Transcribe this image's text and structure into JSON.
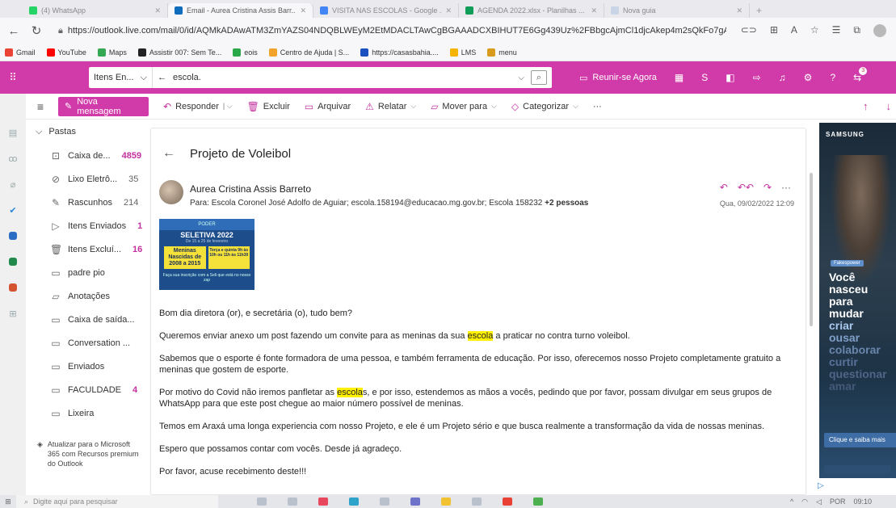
{
  "browser": {
    "tabs": [
      {
        "title": "(4) WhatsApp",
        "active": false
      },
      {
        "title": "Email - Aurea Cristina Assis Barr...",
        "active": true
      },
      {
        "title": "VISITA NAS ESCOLAS - Google ...",
        "active": false
      },
      {
        "title": "AGENDA 2022.xlsx - Planilhas ...",
        "active": false
      },
      {
        "title": "Nova guia",
        "active": false
      }
    ],
    "url": "https://outlook.live.com/mail/0/id/AQMkADAwATM3ZmYAZS04NDQBLWEyM2EtMDACLTAwCgBGAAADCXBIHUT7E6Gg439Uz%2FBbgcAjmCl1djcAkep4m2sQkFo7gAA...",
    "bookmarks": [
      {
        "label": "Gmail",
        "color": "#ea4335"
      },
      {
        "label": "YouTube",
        "color": "#ff0000"
      },
      {
        "label": "Maps",
        "color": "#34a853"
      },
      {
        "label": "Assistir 007: Sem Te...",
        "color": "#222222"
      },
      {
        "label": "eois",
        "color": "#2aa84a"
      },
      {
        "label": "Centro de Ajuda | S...",
        "color": "#f1a32b"
      },
      {
        "label": "https://casasbahia....",
        "color": "#1a4fbf"
      },
      {
        "label": "LMS",
        "color": "#f5b400"
      },
      {
        "label": "menu",
        "color": "#d99b1e"
      }
    ]
  },
  "header": {
    "scope_label": "Itens En...",
    "search_value": "escola.",
    "meet_label": "Reunir-se Agora",
    "notification_count": "3"
  },
  "commands": {
    "new_message": "Nova mensagem",
    "reply": "Responder",
    "delete": "Excluir",
    "archive": "Arquivar",
    "report": "Relatar",
    "move_to": "Mover para",
    "categorize": "Categorizar",
    "more": "···"
  },
  "folders": {
    "title": "Pastas",
    "items": [
      {
        "label": "Caixa de...",
        "count": "4859",
        "bold": true,
        "icon": "inbox-icon"
      },
      {
        "label": "Lixo Eletrô...",
        "count": "35",
        "bold": false,
        "icon": "junk-icon"
      },
      {
        "label": "Rascunhos",
        "count": "214",
        "bold": false,
        "icon": "drafts-icon"
      },
      {
        "label": "Itens Enviados",
        "count": "1",
        "bold": true,
        "icon": "sent-icon"
      },
      {
        "label": "Itens Excluí...",
        "count": "16",
        "bold": true,
        "icon": "trash-icon"
      },
      {
        "label": "padre pio",
        "count": "",
        "bold": false,
        "icon": "archive-icon"
      },
      {
        "label": "Anotações",
        "count": "",
        "bold": false,
        "icon": "notes-icon"
      },
      {
        "label": "Caixa de saída...",
        "count": "",
        "bold": false,
        "icon": "folder-icon"
      },
      {
        "label": "Conversation ...",
        "count": "",
        "bold": false,
        "icon": "folder-icon"
      },
      {
        "label": "Enviados",
        "count": "",
        "bold": false,
        "icon": "folder-icon"
      },
      {
        "label": "FACULDADE",
        "count": "4",
        "bold": true,
        "icon": "folder-icon"
      },
      {
        "label": "Lixeira",
        "count": "",
        "bold": false,
        "icon": "folder-icon"
      }
    ],
    "upgrade_text": "Atualizar para o Microsoft 365 com Recursos premium do Outlook"
  },
  "message": {
    "subject": "Projeto de Voleibol",
    "sender": "Aurea Cristina Assis Barreto",
    "to_label": "Para:",
    "recipients": "Escola Coronel José Adolfo de Aguiar;  escola.158194@educacao.mg.gov.br;  Escola 158232",
    "more_recipients": "+2 pessoas",
    "date": "Qua, 09/02/2022 12:09",
    "poster": {
      "top": "PODER",
      "title": "SELETIVA 2022",
      "sub": "De 15 a 25 de fevereiro",
      "box1": "Meninas Nascidas de 2008 a 2015",
      "box2": "Terça e quinta 9h às 10h ou 11h às 11h30",
      "foot": "Faça sua inscrição com a Seli que está no nosso zap"
    },
    "greeting": "Bom dia diretora (or), e secretária (o), tudo bem?",
    "p1_before": "Queremos enviar anexo um post fazendo um convite para as meninas da sua ",
    "p1_mark": "escola",
    "p1_after": " a praticar no contra turno voleibol.",
    "p2": "Sabemos que o esporte é fonte formadora de uma pessoa, e também ferramenta de educação. Por isso, oferecemos nosso Projeto completamente gratuito a meninas que gostem de esporte.",
    "p3_before": "Por motivo do Covid não iremos panfletar as ",
    "p3_mark": "escola",
    "p3_after": "s, e por isso, estendemos as mãos a vocês, pedindo que por favor, possam divulgar em seus grupos de WhatsApp para que este post chegue ao maior número possível de meninas.",
    "p4": "Temos em Araxá uma longa experiencia com nosso Projeto, e ele é um Projeto sério e que busca realmente a transformação da vida de nossas meninas.",
    "p5": "Espero que possamos contar com vocês. Desde já agradeço.",
    "p6": "Por favor, acuse recebimento deste!!!"
  },
  "ad": {
    "brand": "SAMSUNG",
    "tag": "Fakespower",
    "lines": [
      "Você",
      "nasceu",
      "para",
      "mudar",
      "criar",
      "ousar",
      "colaborar",
      "curtir",
      "questionar",
      "amar"
    ],
    "cta": "Clique e saiba mais"
  },
  "taskbar": {
    "search_placeholder": "Digite aqui para pesquisar",
    "lang": "POR",
    "time": "09:10"
  }
}
